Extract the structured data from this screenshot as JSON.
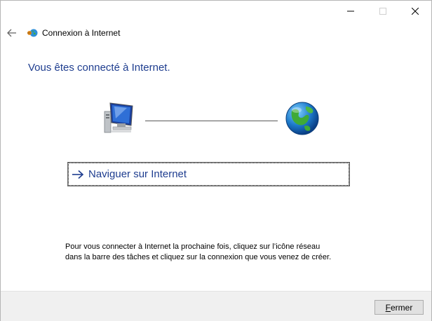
{
  "window": {
    "title": "Connexion à Internet",
    "caption_buttons": [
      "minimize-icon",
      "maximize-icon",
      "close-icon"
    ]
  },
  "header": {
    "back_icon": "arrow-left-icon",
    "app_icon": "network-globe-icon"
  },
  "main": {
    "heading": "Vous êtes connecté à Internet.",
    "illustration": {
      "left": "computer-icon",
      "right": "globe-icon"
    },
    "command_link": {
      "label": "Naviguer sur Internet",
      "icon": "arrow-right-icon"
    },
    "info_text": "Pour vous connecter à Internet la prochaine fois, cliquez sur l’icône réseau dans la barre des tâches et cliquez sur la connexion que vous venez de créer."
  },
  "footer": {
    "close_button": {
      "mnemonic": "F",
      "rest": "ermer"
    }
  },
  "colors": {
    "heading": "#1e3d8f",
    "link": "#1e3d8f",
    "footer_bg": "#f0f0f0"
  }
}
